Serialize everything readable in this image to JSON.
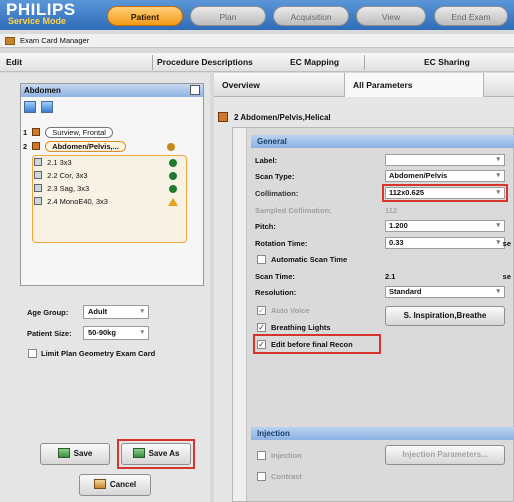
{
  "header": {
    "logo": "PHILIPS",
    "mode": "Service Mode",
    "tabs": [
      "Patient",
      "Plan",
      "Acquisition",
      "View",
      "End Exam"
    ],
    "colors": {
      "bar": "#2f6cb7",
      "active_tab": "#f39a1a",
      "highlight": "#d6342c"
    }
  },
  "window": {
    "title": "Exam Card Manager",
    "icon": "exam-card-icon"
  },
  "menubar": {
    "items": [
      "Edit",
      "Procedure Descriptions",
      "EC Mapping",
      "EC Sharing"
    ]
  },
  "tree": {
    "title": "Abdomen",
    "items": [
      {
        "num": "1",
        "label": "Surview, Frontal"
      },
      {
        "num": "2",
        "label": "Abdomen/Pelvis,..."
      },
      {
        "num": "",
        "label": "2.1 3x3"
      },
      {
        "num": "",
        "label": "2.2 Cor, 3x3"
      },
      {
        "num": "",
        "label": "2.3 Sag, 3x3"
      },
      {
        "num": "",
        "label": "2.4 MonoE40, 3x3"
      }
    ]
  },
  "left": {
    "age_group_label": "Age Group:",
    "age_group_value": "Adult",
    "patient_size_label": "Patient Size:",
    "patient_size_value": "50-90kg",
    "limit_plan_label": "Limit Plan Geometry Exam Card",
    "save_label": "Save",
    "save_as_label": "Save As",
    "cancel_label": "Cancel"
  },
  "right": {
    "tabs": [
      "Overview",
      "All Parameters"
    ],
    "scan_header": "2  Abdomen/Pelvis,Helical",
    "general_section": "General",
    "label_label": "Label:",
    "scan_type_label": "Scan Type:",
    "scan_type_value": "Abdomen/Pelvis",
    "collimation_label": "Collimation:",
    "collimation_value": "112x0.625",
    "sampled_collimation_label": "Sampled Collimation:",
    "sampled_collimation_value": "112",
    "pitch_label": "Pitch:",
    "pitch_value": "1.200",
    "rotation_time_label": "Rotation Time:",
    "rotation_time_value": "0.33",
    "rotation_unit": "se",
    "automatic_scan_time_label": "Automatic Scan Time",
    "scan_time_label": "Scan Time:",
    "scan_time_value": "2.1",
    "scan_time_unit": "se",
    "resolution_label": "Resolution:",
    "resolution_value": "Standard",
    "auto_voice_label": "Auto Voice",
    "breathing_lights_label": "Breathing Lights",
    "edit_before_label": "Edit before final Recon",
    "breathe_button": "S. Inspiration,Breathe",
    "injection_section": "Injection",
    "injection_label": "Injection",
    "injection_params_button": "Injection Parameters...",
    "contrast_label": "Contrast"
  }
}
